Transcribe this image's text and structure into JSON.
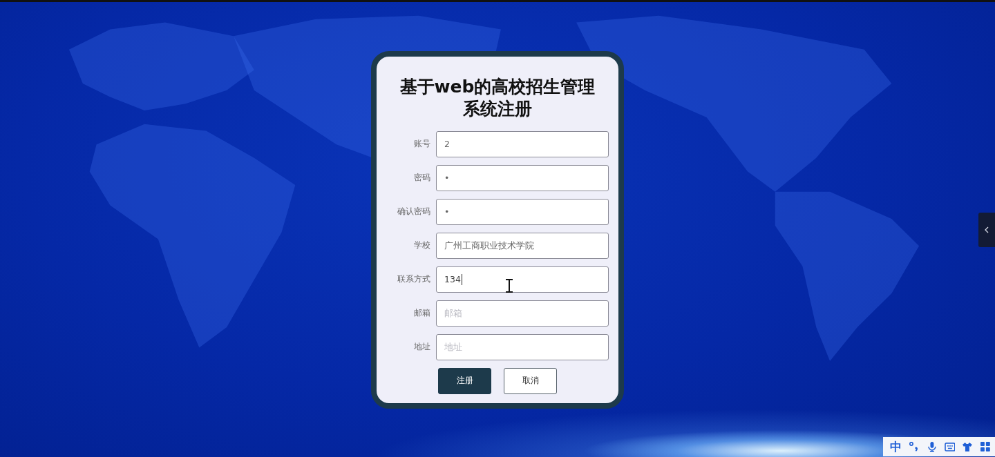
{
  "form": {
    "title": "基于web的高校招生管理系统注册",
    "fields": [
      {
        "label": "账号",
        "value": "2",
        "focused": false
      },
      {
        "label": "密码",
        "value": "•",
        "focused": false
      },
      {
        "label": "确认密码",
        "value": "•",
        "focused": false
      },
      {
        "label": "学校",
        "value": "广州工商职业技术学院",
        "focused": false
      },
      {
        "label": "联系方式",
        "value": "134",
        "focused": true
      },
      {
        "label": "邮箱",
        "placeholder": "邮箱",
        "focused": false
      },
      {
        "label": "地址",
        "placeholder": "地址",
        "focused": false
      }
    ],
    "buttons": [
      {
        "label": "注册",
        "kind": "primary"
      },
      {
        "label": "取消",
        "kind": "secondary"
      }
    ]
  },
  "ime_toolbar": {
    "mode": "中"
  }
}
